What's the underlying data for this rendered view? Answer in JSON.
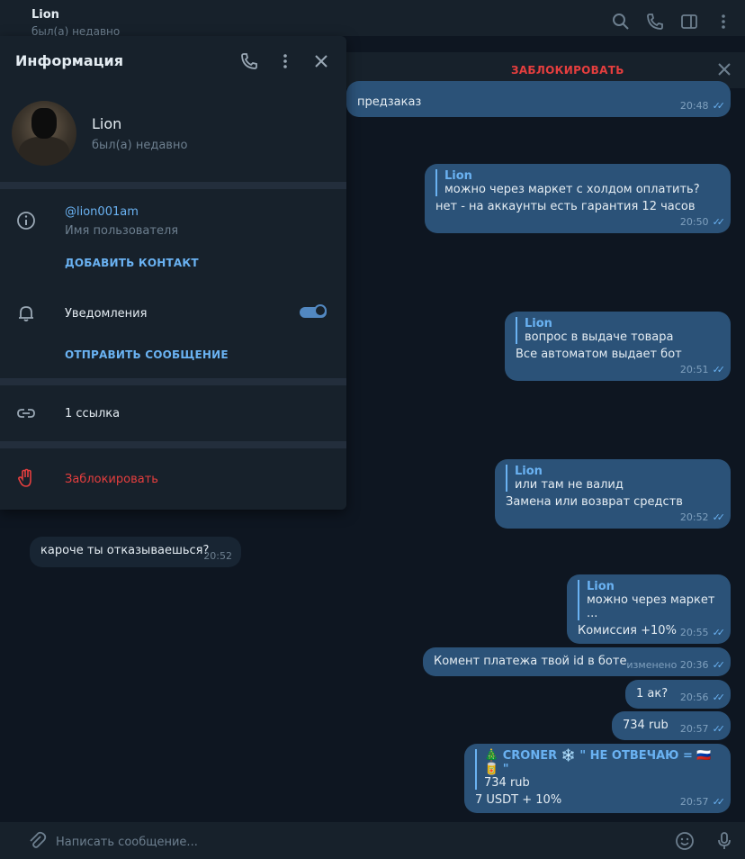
{
  "header": {
    "title": "Lion",
    "status": "был(а) недавно"
  },
  "block_bar": {
    "label": "ЗАБЛОКИРОВАТЬ"
  },
  "messages": [
    {
      "dir": "out",
      "text": "предзаказ",
      "time": "20:48"
    },
    {
      "dir": "out",
      "quote_name": "Lion",
      "quote_text": "можно через маркет с холдом оплатить?",
      "text": "нет - на аккаунты есть гарантия 12 часов",
      "time": "20:50"
    },
    {
      "dir": "out",
      "quote_name": "Lion",
      "quote_text": "вопрос в выдаче товара",
      "text": "Все автоматом выдает бот",
      "time": "20:51"
    },
    {
      "dir": "out",
      "quote_name": "Lion",
      "quote_text": "или там не валид",
      "text": "Замена или возврат средств",
      "time": "20:52"
    },
    {
      "dir": "in",
      "text": "кароче ты отказываешься?",
      "time": "20:52"
    },
    {
      "dir": "out",
      "quote_name": "Lion",
      "quote_text": "можно через маркет ...",
      "text": "Комиссия +10%",
      "time": "20:55"
    },
    {
      "dir": "out",
      "text": "Комент платежа твой id в боте",
      "time": "изменено 20:36"
    },
    {
      "dir": "out",
      "text": "1 ак?",
      "time": "20:56"
    },
    {
      "dir": "out",
      "text": "734 rub",
      "time": "20:57"
    },
    {
      "dir": "out",
      "quote_name": "🎄 CRONER ❄️ \" НЕ ОТВЕЧАЮ = 🇷🇺 🥫 \"",
      "quote_text": "734 rub",
      "text": "7 USDT + 10%",
      "time": "20:57"
    }
  ],
  "composer": {
    "placeholder": "Написать сообщение..."
  },
  "info_panel": {
    "title": "Информация",
    "name": "Lion",
    "status": "был(а) недавно",
    "username": "@lion001am",
    "username_label": "Имя пользователя",
    "add_contact": "ДОБАВИТЬ КОНТАКТ",
    "notifications_label": "Уведомления",
    "notifications_on": true,
    "send_message": "ОТПРАВИТЬ СООБЩЕНИЕ",
    "links": "1 ссылка",
    "block": "Заблокировать"
  },
  "colors": {
    "background": "#0e1621",
    "panel": "#17212b",
    "outgoing": "#2b5278",
    "incoming": "#182533",
    "accent": "#6ab2f2",
    "danger": "#e53e3e"
  },
  "icons": [
    "search-icon",
    "phone-icon",
    "sidebar-icon",
    "more-icon",
    "close-icon",
    "info-icon",
    "bell-icon",
    "link-icon",
    "hand-icon",
    "attach-icon",
    "emoji-icon",
    "mic-icon"
  ]
}
